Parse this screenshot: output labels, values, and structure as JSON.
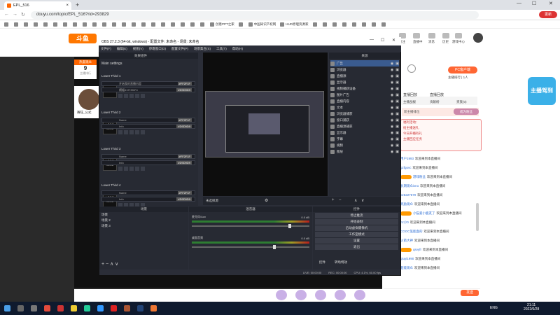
{
  "browser": {
    "tab_title": "EPL_516",
    "url": "douyu.com/topic/EPL_516?rid=293829",
    "update_label": "更新",
    "bookmarks": [
      "",
      "",
      "",
      "",
      "",
      "",
      "",
      "",
      "",
      "",
      "",
      "",
      "",
      "",
      "",
      "",
      "",
      "",
      "",
      "",
      "",
      "创意PPT之家",
      "",
      "中国知识产权网",
      "HUD原理资源家",
      "",
      "",
      "",
      "",
      "",
      "",
      "",
      ""
    ]
  },
  "site": {
    "logo": "斗鱼",
    "nav_labels": [
      "",
      "",
      "",
      "",
      "",
      "下载",
      "",
      "",
      "",
      "",
      ""
    ],
    "header_item_labels": [
      "关注",
      "直播中",
      "消息",
      "历史",
      "游戏中心"
    ],
    "hot_label": "热度观众",
    "hot_value": "9",
    "hot_sub": "主播排行",
    "anchor_name": "赛旺_公式",
    "pc_button": "PC客户端",
    "sub_text": "主播排行 | 1人",
    "mascot_text": "主播驾到",
    "tabs": [
      "直播回放",
      "直播回放",
      "直播回放"
    ],
    "sub_tabs": [
      "主播战报",
      "贡献榜",
      "贵族(0)",
      "",
      ""
    ],
    "banner_text": "新主播排位",
    "rank_button": "成为粉丝",
    "gift_lines": [
      "福利活动：",
      "给主播送礼",
      "今日开播有礼",
      "主播回应任务"
    ],
    "chat": [
      {
        "user": "用户1993",
        "msg": "欢迎来到本直播间"
      },
      {
        "user": "gzfgovc",
        "msg": "欢迎来到本直播间"
      },
      {
        "user": "游戏粉丝",
        "msg": "欢迎来到本直播间"
      },
      {
        "user": "长期观众ivno",
        "msg": "欢迎来到本直播间"
      },
      {
        "user": "bz5227570",
        "msg": "欢迎来到本直播间"
      },
      {
        "user": "奖励观众",
        "msg": "欢迎来到本直播间"
      },
      {
        "user": "小猫爱小鹿友了",
        "msg": "欢迎来到本直播间"
      },
      {
        "user": "hz小0",
        "msg": "欢迎来到本直播间"
      },
      {
        "user": "CGOC氢能喜的",
        "msg": "欢迎来到本直播间"
      },
      {
        "user": "火箭大神",
        "msg": "欢迎来到本直播间"
      },
      {
        "user": "qsvyfr",
        "msg": "欢迎来到本直播间"
      },
      {
        "user": "qiuyi1990",
        "msg": "欢迎来到本直播间"
      },
      {
        "user": "超能观众",
        "msg": "欢迎来到本直播间"
      }
    ],
    "chat_send": "发送"
  },
  "obs": {
    "title": "OBS 27.2.3 (64-bit, windows) - 配置文件: 未命名 - 场景: 未命名",
    "menu": [
      "文件(F)",
      "编辑(E)",
      "视图(V)",
      "停靠窗口(D)",
      "配置文件(P)",
      "场景集合(S)",
      "工具(T)",
      "帮助(H)"
    ],
    "dock_title": "效果组件",
    "main_settings": "Main settings",
    "lower_thirds": [
      {
        "name": "Lower Third 1",
        "line1": "开始我的直播内容",
        "line2": "横幅415*355*4",
        "tag1": "#FF2F1F",
        "tag2": "#D9D9D9",
        "logo": "LOGO"
      },
      {
        "name": "Lower Third 2",
        "line1": "Name",
        "line2": "Info",
        "tag1": "#FF2F1F",
        "tag2": "#D9D9D9",
        "logo": "YOUR LOGO HERE"
      },
      {
        "name": "Lower Third 3",
        "line1": "Name",
        "line2": "Info",
        "tag1": "#FF2F1F",
        "tag2": "#D9D9D9",
        "logo": "YOUR LOGO HERE"
      },
      {
        "name": "Lower Third 4",
        "line1": "Name",
        "line2": "Info",
        "tag1": "#FF2F1F",
        "tag2": "#D9D9D9",
        "logo": "YOUR LOGO HERE"
      }
    ],
    "sources_title": "来源",
    "sources": [
      "广告",
      "浏览器",
      "直播源",
      "显示器",
      "视频捕获设备",
      "图片广告",
      "直播内容",
      "文本",
      "浏览器捕获",
      "窗口捕获",
      "直播源捕获",
      "显示器",
      "字幕",
      "视频",
      "图层"
    ],
    "preview_scene": "未选择源",
    "scenes_title": "场景",
    "scenes": [
      "场景",
      "场景 2",
      "场景 3"
    ],
    "mixer_title": "混音器",
    "mixer": [
      {
        "name": "麦克风/Aux",
        "level": "0.0 dB"
      },
      {
        "name": "桌面音频",
        "level": "0.0 dB"
      }
    ],
    "controls_title": "控件",
    "controls": [
      "停止推流",
      "开始录制",
      "启动虚拟摄像机",
      "工作室模式",
      "设置",
      "退出"
    ],
    "dock_tabs": [
      "控件",
      "转场特效"
    ],
    "status": [
      "LIVE: 00:00:00",
      "REC: 00:00:00",
      "CPU: 4.1%, 60.00 fps"
    ]
  },
  "taskbar": {
    "time": "21:11",
    "date": "2022/6/28",
    "lang": "ENG"
  },
  "colors": {
    "accent": "#ff6a00",
    "obs_bg": "#2b2e38",
    "taskbar": "#0f1a2e"
  }
}
